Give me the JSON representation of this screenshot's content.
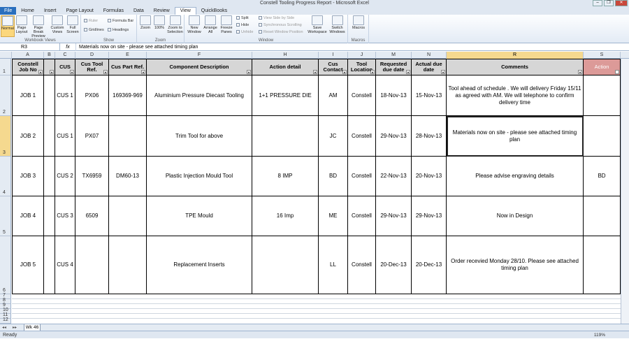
{
  "window": {
    "title": "Constell Tooling Progress Report - Microsoft Excel"
  },
  "ribbon_tabs": [
    "File",
    "Home",
    "Insert",
    "Page Layout",
    "Formulas",
    "Data",
    "Review",
    "View",
    "QuickBooks"
  ],
  "ribbon": {
    "workbook_views": {
      "label": "Workbook Views",
      "buttons": [
        "Normal",
        "Page Layout",
        "Page Break Preview",
        "Custom Views",
        "Full Screen"
      ]
    },
    "show": {
      "label": "Show",
      "checks": [
        "Ruler",
        "Formula Bar",
        "Gridlines",
        "Headings"
      ]
    },
    "zoom": {
      "label": "Zoom",
      "buttons": [
        "Zoom",
        "100%",
        "Zoom to Selection"
      ]
    },
    "window": {
      "label": "Window",
      "buttons": [
        "New Window",
        "Arrange All",
        "Freeze Panes"
      ],
      "small": [
        "Split",
        "Hide",
        "Unhide",
        "View Side by Side",
        "Synchronous Scrolling",
        "Reset Window Position"
      ],
      "save": "Save Workspace",
      "switch": "Switch Windows"
    },
    "macros": {
      "label": "Macros",
      "button": "Macros"
    }
  },
  "formula_bar": {
    "name_box": "R3",
    "fx": "fx",
    "formula": "Materials now on site - please see attached timing plan"
  },
  "columns": [
    "A",
    "B",
    "C",
    "D",
    "E",
    "F",
    "H",
    "I",
    "J",
    "M",
    "N",
    "R",
    "S"
  ],
  "row_numbers": [
    "1",
    "2",
    "3",
    "4",
    "5",
    "6",
    "7",
    "8",
    "9",
    "10",
    "11",
    "12"
  ],
  "headers": {
    "job": "Constell Job No",
    "cus": "CUS",
    "tool": "Cus Tool Ref.",
    "part": "Cus Part Ref.",
    "desc": "Component Description",
    "action": "Action detail",
    "contact": "Cus Contact",
    "loc": "Tool Location",
    "req": "Requested due date",
    "actual": "Actual due date",
    "comments": "Comments",
    "actionS": "Action"
  },
  "rows": [
    {
      "job": "JOB 1",
      "cus": "CUS 1",
      "tool": "PX06",
      "part": "169369-969",
      "desc": "Aluminium Pressure Diecast Tooling",
      "action": "1+1 PRESSURE DIE",
      "contact": "AM",
      "loc": "Constell",
      "req": "18-Nov-13",
      "actual": "15-Nov-13",
      "comments": "Tool ahead of schedule .  We will delivery Friday 15/11 as agreed with AM. We will telephone to confirm delivery time",
      "s": ""
    },
    {
      "job": "JOB 2",
      "cus": "CUS 1",
      "tool": "PX07",
      "part": "",
      "desc": "Trim Tool for above",
      "action": "",
      "contact": "JC",
      "loc": "Constell",
      "req": "29-Nov-13",
      "actual": "28-Nov-13",
      "comments": "Materials now on site - please see attached timing plan",
      "s": ""
    },
    {
      "job": "JOB 3",
      "cus": "CUS 2",
      "tool": "TX6959",
      "part": "DM60-13",
      "desc": "Plastic Injection Mould Tool",
      "action": "8 IMP",
      "contact": "BD",
      "loc": "Constell",
      "req": "22-Nov-13",
      "actual": "20-Nov-13",
      "comments": "Please advise engraving details",
      "s": "BD"
    },
    {
      "job": "JOB 4",
      "cus": "CUS 3",
      "tool": "6509",
      "part": "",
      "desc": "TPE Mould",
      "action": "16 Imp",
      "contact": "ME",
      "loc": "Constell",
      "req": "29-Nov-13",
      "actual": "29-Nov-13",
      "comments": "Now in Design",
      "s": ""
    },
    {
      "job": "JOB 5",
      "cus": "CUS 4",
      "tool": "",
      "part": "",
      "desc": "Replacement Inserts",
      "action": "",
      "contact": "LL",
      "loc": "Constell",
      "req": "20-Dec-13",
      "actual": "20-Dec-13",
      "comments": "Order recevied Monday 28/10.  Please see attached timing plan",
      "s": ""
    }
  ],
  "sheet_tab": "Wk 46",
  "status": {
    "ready": "Ready",
    "zoom": "119%"
  }
}
